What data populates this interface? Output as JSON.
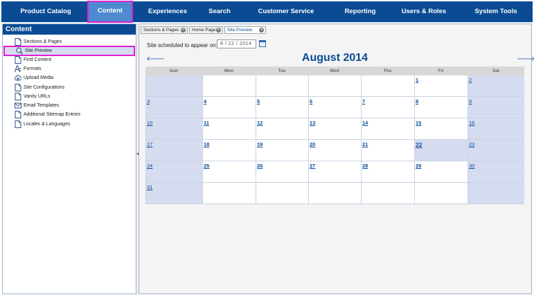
{
  "nav": {
    "items": [
      {
        "label": "Product Catalog"
      },
      {
        "label": "Content"
      },
      {
        "label": "Experiences"
      },
      {
        "label": "Search"
      },
      {
        "label": "Customer Service"
      },
      {
        "label": "Reporting"
      },
      {
        "label": "Users & Roles"
      },
      {
        "label": "System Tools"
      }
    ],
    "active": "Content"
  },
  "sidebar": {
    "title": "Content",
    "items": [
      {
        "label": "Sections & Pages",
        "icon": "page-icon"
      },
      {
        "label": "Site Preview",
        "icon": "magnifier-icon",
        "selected": true
      },
      {
        "label": "Find Content",
        "icon": "page-icon"
      },
      {
        "label": "Formats",
        "icon": "format-icon"
      },
      {
        "label": "Upload Media",
        "icon": "upload-cloud-icon"
      },
      {
        "label": "Site Configurations",
        "icon": "page-icon"
      },
      {
        "label": "Vanity URLs",
        "icon": "page-icon"
      },
      {
        "label": "Email Templates",
        "icon": "envelope-icon"
      },
      {
        "label": "Additional Sitemap Entries",
        "icon": "page-icon"
      },
      {
        "label": "Locales & Languages",
        "icon": "page-icon"
      }
    ]
  },
  "tabs": [
    {
      "label": "Sections & Pages",
      "closable": true
    },
    {
      "label": "Home Page",
      "closable": true
    },
    {
      "label": "Site Preview",
      "closable": true,
      "active": true
    }
  ],
  "preview": {
    "schedule_label": "Site scheduled to appear on:",
    "date_value": "8 / 22 / 2014"
  },
  "calendar": {
    "title": "August 2014",
    "prev_label": "🡐",
    "next_label": "🡒",
    "weekdays": [
      "Sun",
      "Mon",
      "Tue",
      "Wed",
      "Thu",
      "Fri",
      "Sat"
    ],
    "weeks": [
      [
        "",
        "",
        "",
        "",
        "",
        "1",
        "2"
      ],
      [
        "3",
        "4",
        "5",
        "6",
        "7",
        "8",
        "9"
      ],
      [
        "10",
        "11",
        "12",
        "13",
        "14",
        "15",
        "16"
      ],
      [
        "17",
        "18",
        "19",
        "20",
        "21",
        "22",
        "23"
      ],
      [
        "24",
        "25",
        "26",
        "27",
        "28",
        "29",
        "30"
      ],
      [
        "31",
        "",
        "",
        "",
        "",
        "",
        ""
      ]
    ],
    "selected_day": "22"
  },
  "colors": {
    "nav_bg": "#0a4b94",
    "nav_active_bg": "#4f8ad0",
    "highlight_border": "#e01fd4",
    "weekend_bg": "#d6dcf0",
    "link": "#0a4b94"
  }
}
